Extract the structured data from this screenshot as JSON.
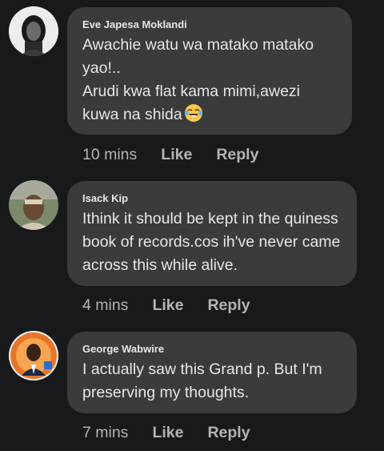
{
  "comments": [
    {
      "author": "Eve Japesa Moklandi",
      "text": "Awachie watu wa matako matako yao!..\nArudi kwa flat kama mimi,awezi kuwa na shida",
      "emoji": "crying-laughing-emoji",
      "time": "10 mins",
      "like_label": "Like",
      "reply_label": "Reply"
    },
    {
      "author": "Isack Kip",
      "text": "Ithink it should be kept in the quiness book of records.cos ih've never came across this while alive.",
      "time": "4 mins",
      "like_label": "Like",
      "reply_label": "Reply"
    },
    {
      "author": "George Wabwire",
      "text": "I actually saw this Grand p. But I'm preserving my thoughts.",
      "time": "7 mins",
      "like_label": "Like",
      "reply_label": "Reply"
    }
  ],
  "colors": {
    "background": "#18191a",
    "bubble": "#3a3b3c",
    "text": "#e4e6eb",
    "secondary": "#b0b3b8"
  }
}
